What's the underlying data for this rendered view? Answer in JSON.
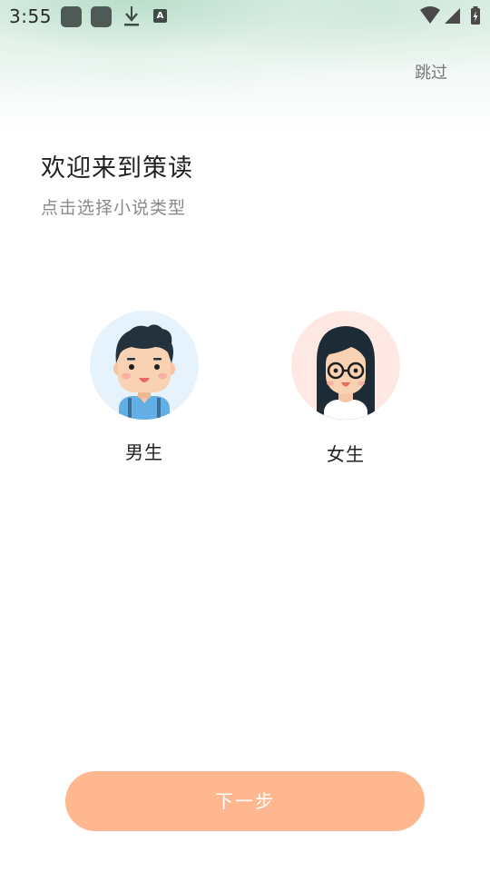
{
  "status_bar": {
    "time": "3:55",
    "notification_icons": [
      "app-icon",
      "app-icon",
      "download-icon",
      "font-a-icon"
    ],
    "font_icon_letter": "A",
    "system_icons": [
      "wifi-icon",
      "cellular-signal-icon",
      "battery-charging-icon"
    ]
  },
  "header": {
    "skip_label": "跳过"
  },
  "welcome": {
    "title": "欢迎来到策读",
    "subtitle": "点击选择小说类型"
  },
  "genders": [
    {
      "label": "男生",
      "icon": "boy-avatar-icon",
      "background": "#e6f2fc"
    },
    {
      "label": "女生",
      "icon": "girl-avatar-icon",
      "background": "#fde8e4"
    }
  ],
  "next_button": {
    "label": "下一步",
    "color": "#ffb78f"
  }
}
